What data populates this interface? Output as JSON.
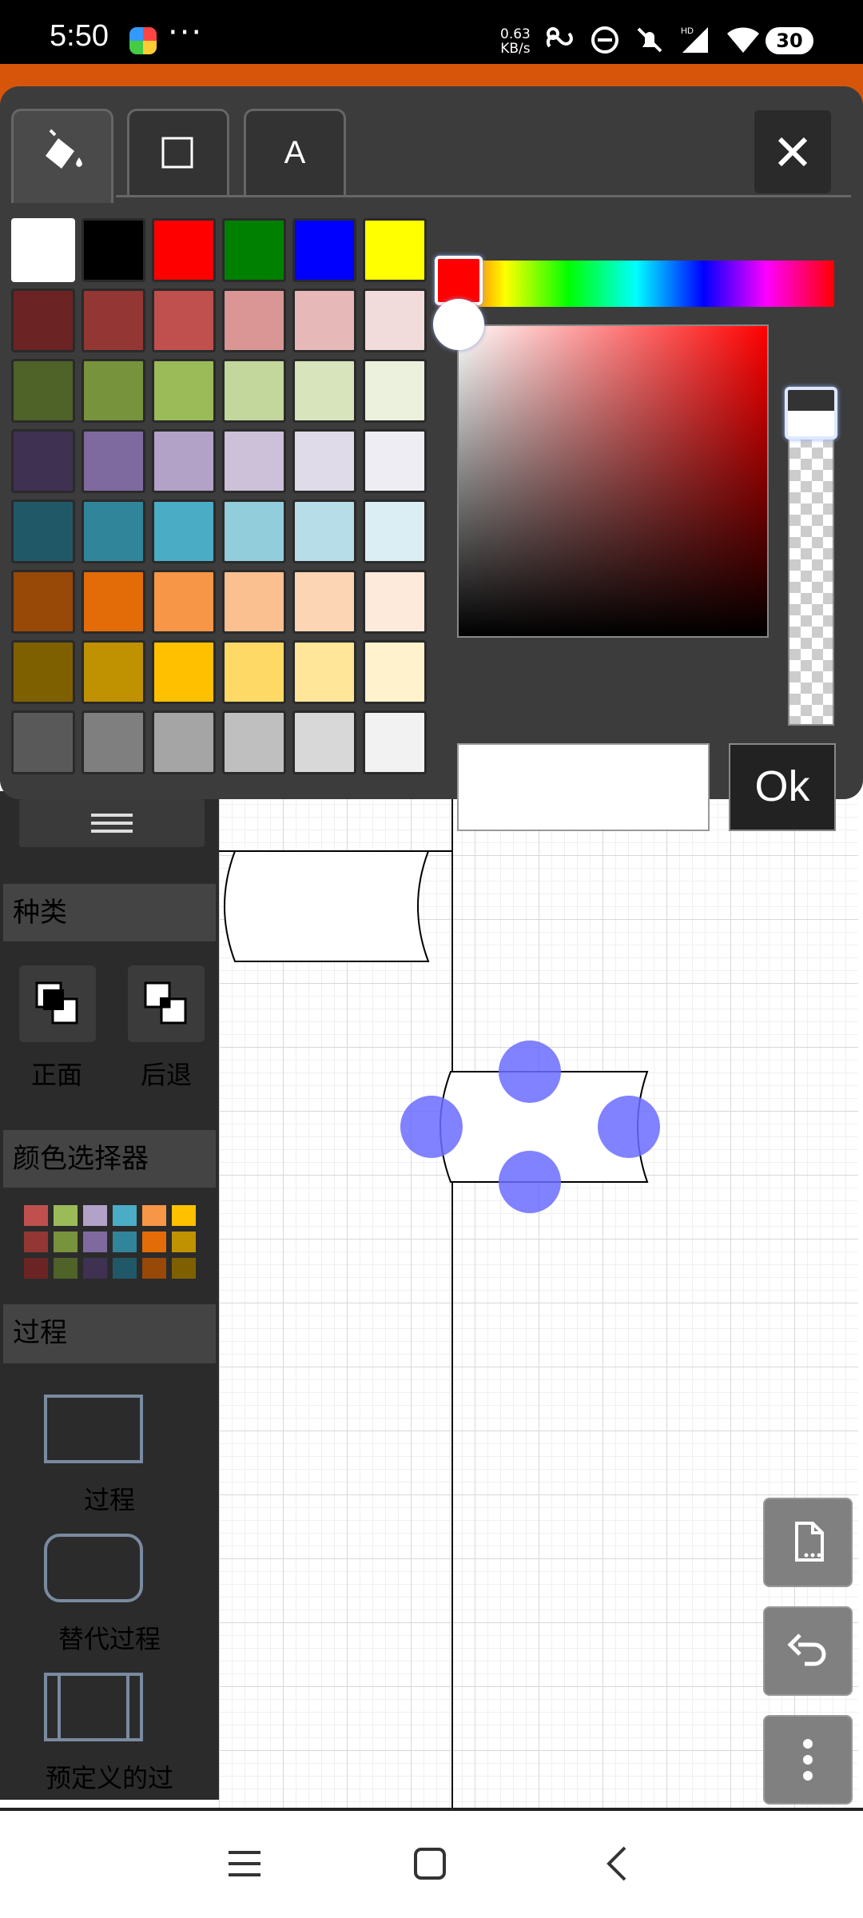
{
  "status_bar": {
    "time": "5:50",
    "more": "···",
    "net_speed_value": "0.63",
    "net_speed_unit": "KB/s",
    "battery": "30"
  },
  "left_panel": {
    "section_kind": "种类",
    "btn_front": "正面",
    "btn_back": "后退",
    "section_color": "颜色选择器",
    "section_process": "过程",
    "shape_process": "过程",
    "shape_alt_process": "替代过程",
    "shape_predefined": "预定义的过"
  },
  "color_popup": {
    "tab_text_label": "A",
    "ok_label": "Ok",
    "hex_value": "",
    "selected_color": "#ff0000",
    "palette": [
      "#ffffff",
      "#000000",
      "#ff0000",
      "#008000",
      "#0000ff",
      "#ffff00",
      "#6b2323",
      "#943634",
      "#c0504d",
      "#d99694",
      "#e6b9b8",
      "#f2dcdb",
      "#4f6228",
      "#77933c",
      "#9bbb59",
      "#c3d69b",
      "#d7e4bc",
      "#ebf1dd",
      "#3f3151",
      "#7f6a9f",
      "#b2a2c7",
      "#ccc1d9",
      "#e0dbe8",
      "#efedf4",
      "#215868",
      "#31859b",
      "#4bacc6",
      "#92cddc",
      "#b7dde8",
      "#dbeef3",
      "#984807",
      "#e36c09",
      "#f79646",
      "#fac08f",
      "#fcd5b4",
      "#fdeada",
      "#7f6000",
      "#c09100",
      "#ffc000",
      "#ffd966",
      "#ffe699",
      "#fff2cc",
      "#595959",
      "#7f7f7f",
      "#a5a5a5",
      "#bfbfbf",
      "#d8d8d8",
      "#f2f2f2"
    ]
  }
}
